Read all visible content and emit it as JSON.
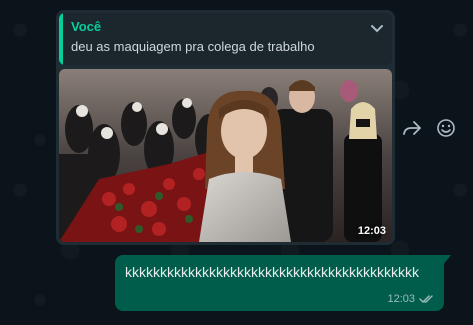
{
  "colors": {
    "background": "#0b141a",
    "incoming_bubble": "#1f2c34",
    "outgoing_bubble": "#005c4b",
    "accent": "#06cf9c",
    "text": "#e9edef"
  },
  "media_message": {
    "quote": {
      "author": "Você",
      "text": "deu as maquiagem pra colega de trabalho",
      "menu_icon": "chevron-down-icon"
    },
    "photo": {
      "alt_icon": "photo-image",
      "time": "12:03"
    },
    "actions": [
      {
        "icon": "forward-icon"
      },
      {
        "icon": "emoji-icon"
      }
    ]
  },
  "outgoing_message": {
    "text": "kkkkkkkkkkkkkkkkkkkkkkkkkkkkkkkkkkkkkkkkkk",
    "time": "12:03",
    "status_icon": "double-check-icon"
  }
}
